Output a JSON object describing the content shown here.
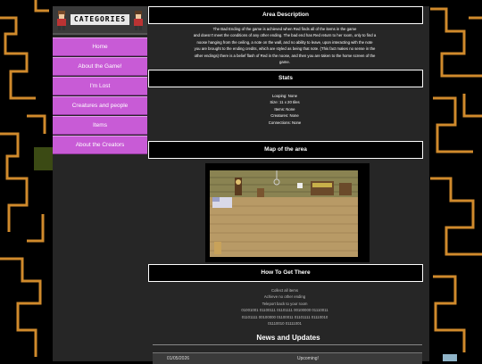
{
  "sidebar": {
    "banner": "CATEGORIES",
    "items": [
      {
        "label": "Home"
      },
      {
        "label": "About the Game!"
      },
      {
        "label": "I'm Lost"
      },
      {
        "label": "Creatures and people"
      },
      {
        "label": "Items"
      },
      {
        "label": "About the Creators"
      }
    ]
  },
  "area_description": {
    "title": "Area Description",
    "lines": [
      "The Bad Ending of the game is achieved when Red finds all of the items in the game",
      "and doesn't meet the conditions of any other ending. The bad end has Red return to her room, only to find a",
      "noose hanging from the ceiling, a note on the wall, and no ability to leave, upon interacting with the note",
      "you are brought to the ending credits, which are styled as being that note. (This fact makes no sense in the",
      "other endings) there is a belief flash of Red in the noose, and then you are taken to the home screen of the",
      "game."
    ]
  },
  "stats": {
    "title": "Stats",
    "lines": [
      "Looping: None",
      "Size: 11 x 20 tiles",
      "Items: None",
      "Creatures: None",
      "Connections: None"
    ]
  },
  "map": {
    "title": "Map of the area"
  },
  "how_to": {
    "title": "How To Get There",
    "lines": [
      "Collect all items",
      "Achieve no other ending",
      "Teleport back to your room",
      "01001001 01100111 01101111 00100000 01110011",
      "01101111 00100000 01100011 01101111 01110010",
      "01110010 01111001"
    ]
  },
  "news": {
    "title": "News and Updates",
    "rows": [
      {
        "date": "01/05/2026",
        "text": "Upcoming!"
      }
    ]
  },
  "colors": {
    "nav": "#c85bd6",
    "panel": "#262626",
    "background": "#000000"
  }
}
